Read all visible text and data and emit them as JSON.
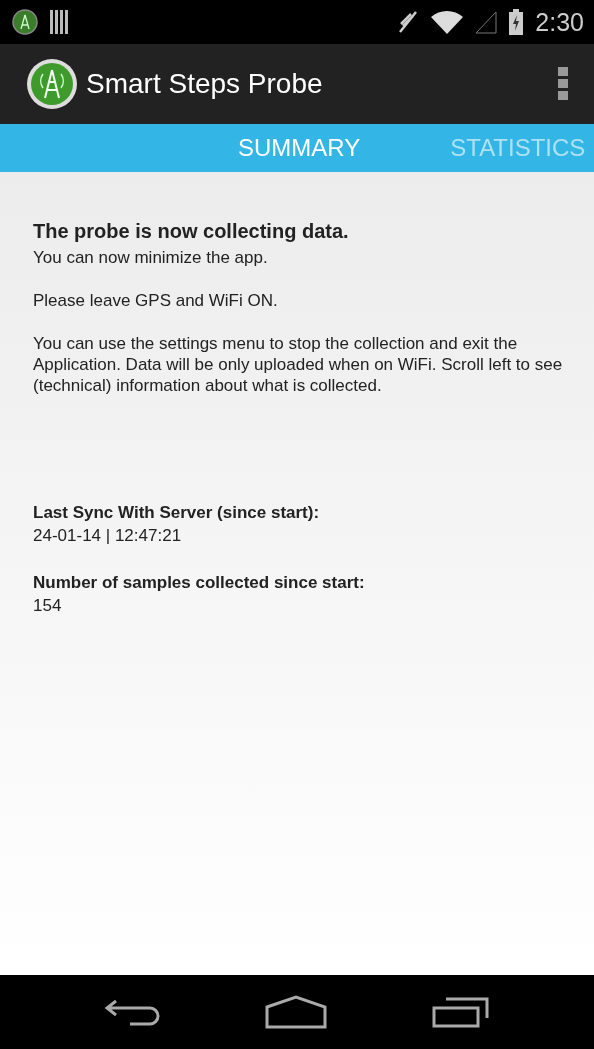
{
  "status_bar": {
    "time": "2:30"
  },
  "action_bar": {
    "title": "Smart Steps Probe"
  },
  "tabs": [
    {
      "label": "SUMMARY",
      "selected": true
    },
    {
      "label": "STATISTICS",
      "selected": false
    }
  ],
  "content": {
    "heading": "The probe is now collecting data.",
    "paragraphs": [
      "You can now minimize the app.",
      "Please leave GPS and WiFi ON.",
      "You can use the settings menu to stop the collection and exit the Application. Data will be only uploaded when on WiFi. Scroll left to see (technical) information about what is collected."
    ],
    "fields": [
      {
        "label": "Last Sync With Server (since start):",
        "value": "24-01-14 | 12:47:21"
      },
      {
        "label": "Number of samples collected since start:",
        "value": "154"
      }
    ]
  }
}
